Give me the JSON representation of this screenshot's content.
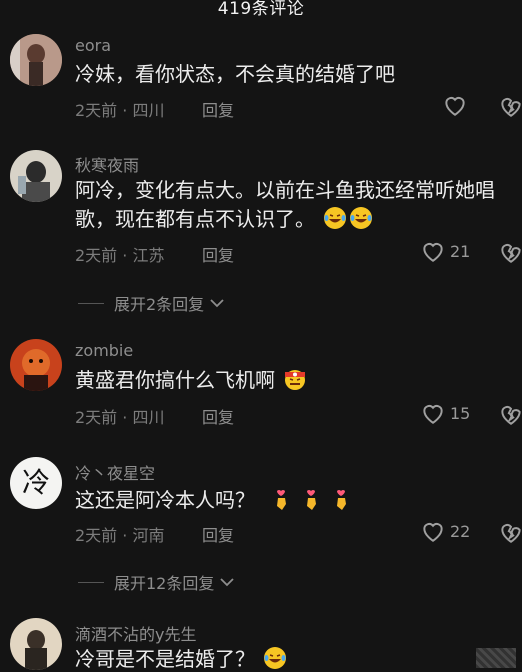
{
  "header": {
    "title": "419条评论"
  },
  "comments": [
    {
      "username": "eora",
      "text": "冷妹，看你状态，不会真的结婚了吧",
      "meta": "2天前 · 四川",
      "reply": "回复",
      "likes": ""
    },
    {
      "username": "秋寒夜雨",
      "text": "阿冷，变化有点大。以前在斗鱼我还经常听她唱歌，现在都有点不认识了。",
      "meta": "2天前 · 江苏",
      "reply": "回复",
      "likes": "21"
    },
    {
      "username": "zombie",
      "text": "黄盛君你搞什么飞机啊",
      "meta": "2天前 · 四川",
      "reply": "回复",
      "likes": "15"
    },
    {
      "username": "冷丶夜星空",
      "text": "这还是阿冷本人吗？",
      "meta": "2天前 · 河南",
      "reply": "回复",
      "likes": "22"
    },
    {
      "username": "滴酒不沾的y先生",
      "text": "冷哥是不是结婚了？",
      "meta": "",
      "reply": "",
      "likes": ""
    }
  ],
  "expand": [
    {
      "label": "展开2条回复"
    },
    {
      "label": "展开12条回复"
    }
  ],
  "avatar_glyphs": {
    "c4": "冷"
  },
  "icons": {
    "like": "heart-outline-icon",
    "dislike": "broken-heart-icon",
    "chevron": "chevron-down-icon"
  },
  "colors": {
    "background": "#141414",
    "text": "#ededed",
    "muted": "#8e8e8e",
    "heart_emoji": "#ff5a78",
    "hand_emoji": "#f5b72a"
  }
}
